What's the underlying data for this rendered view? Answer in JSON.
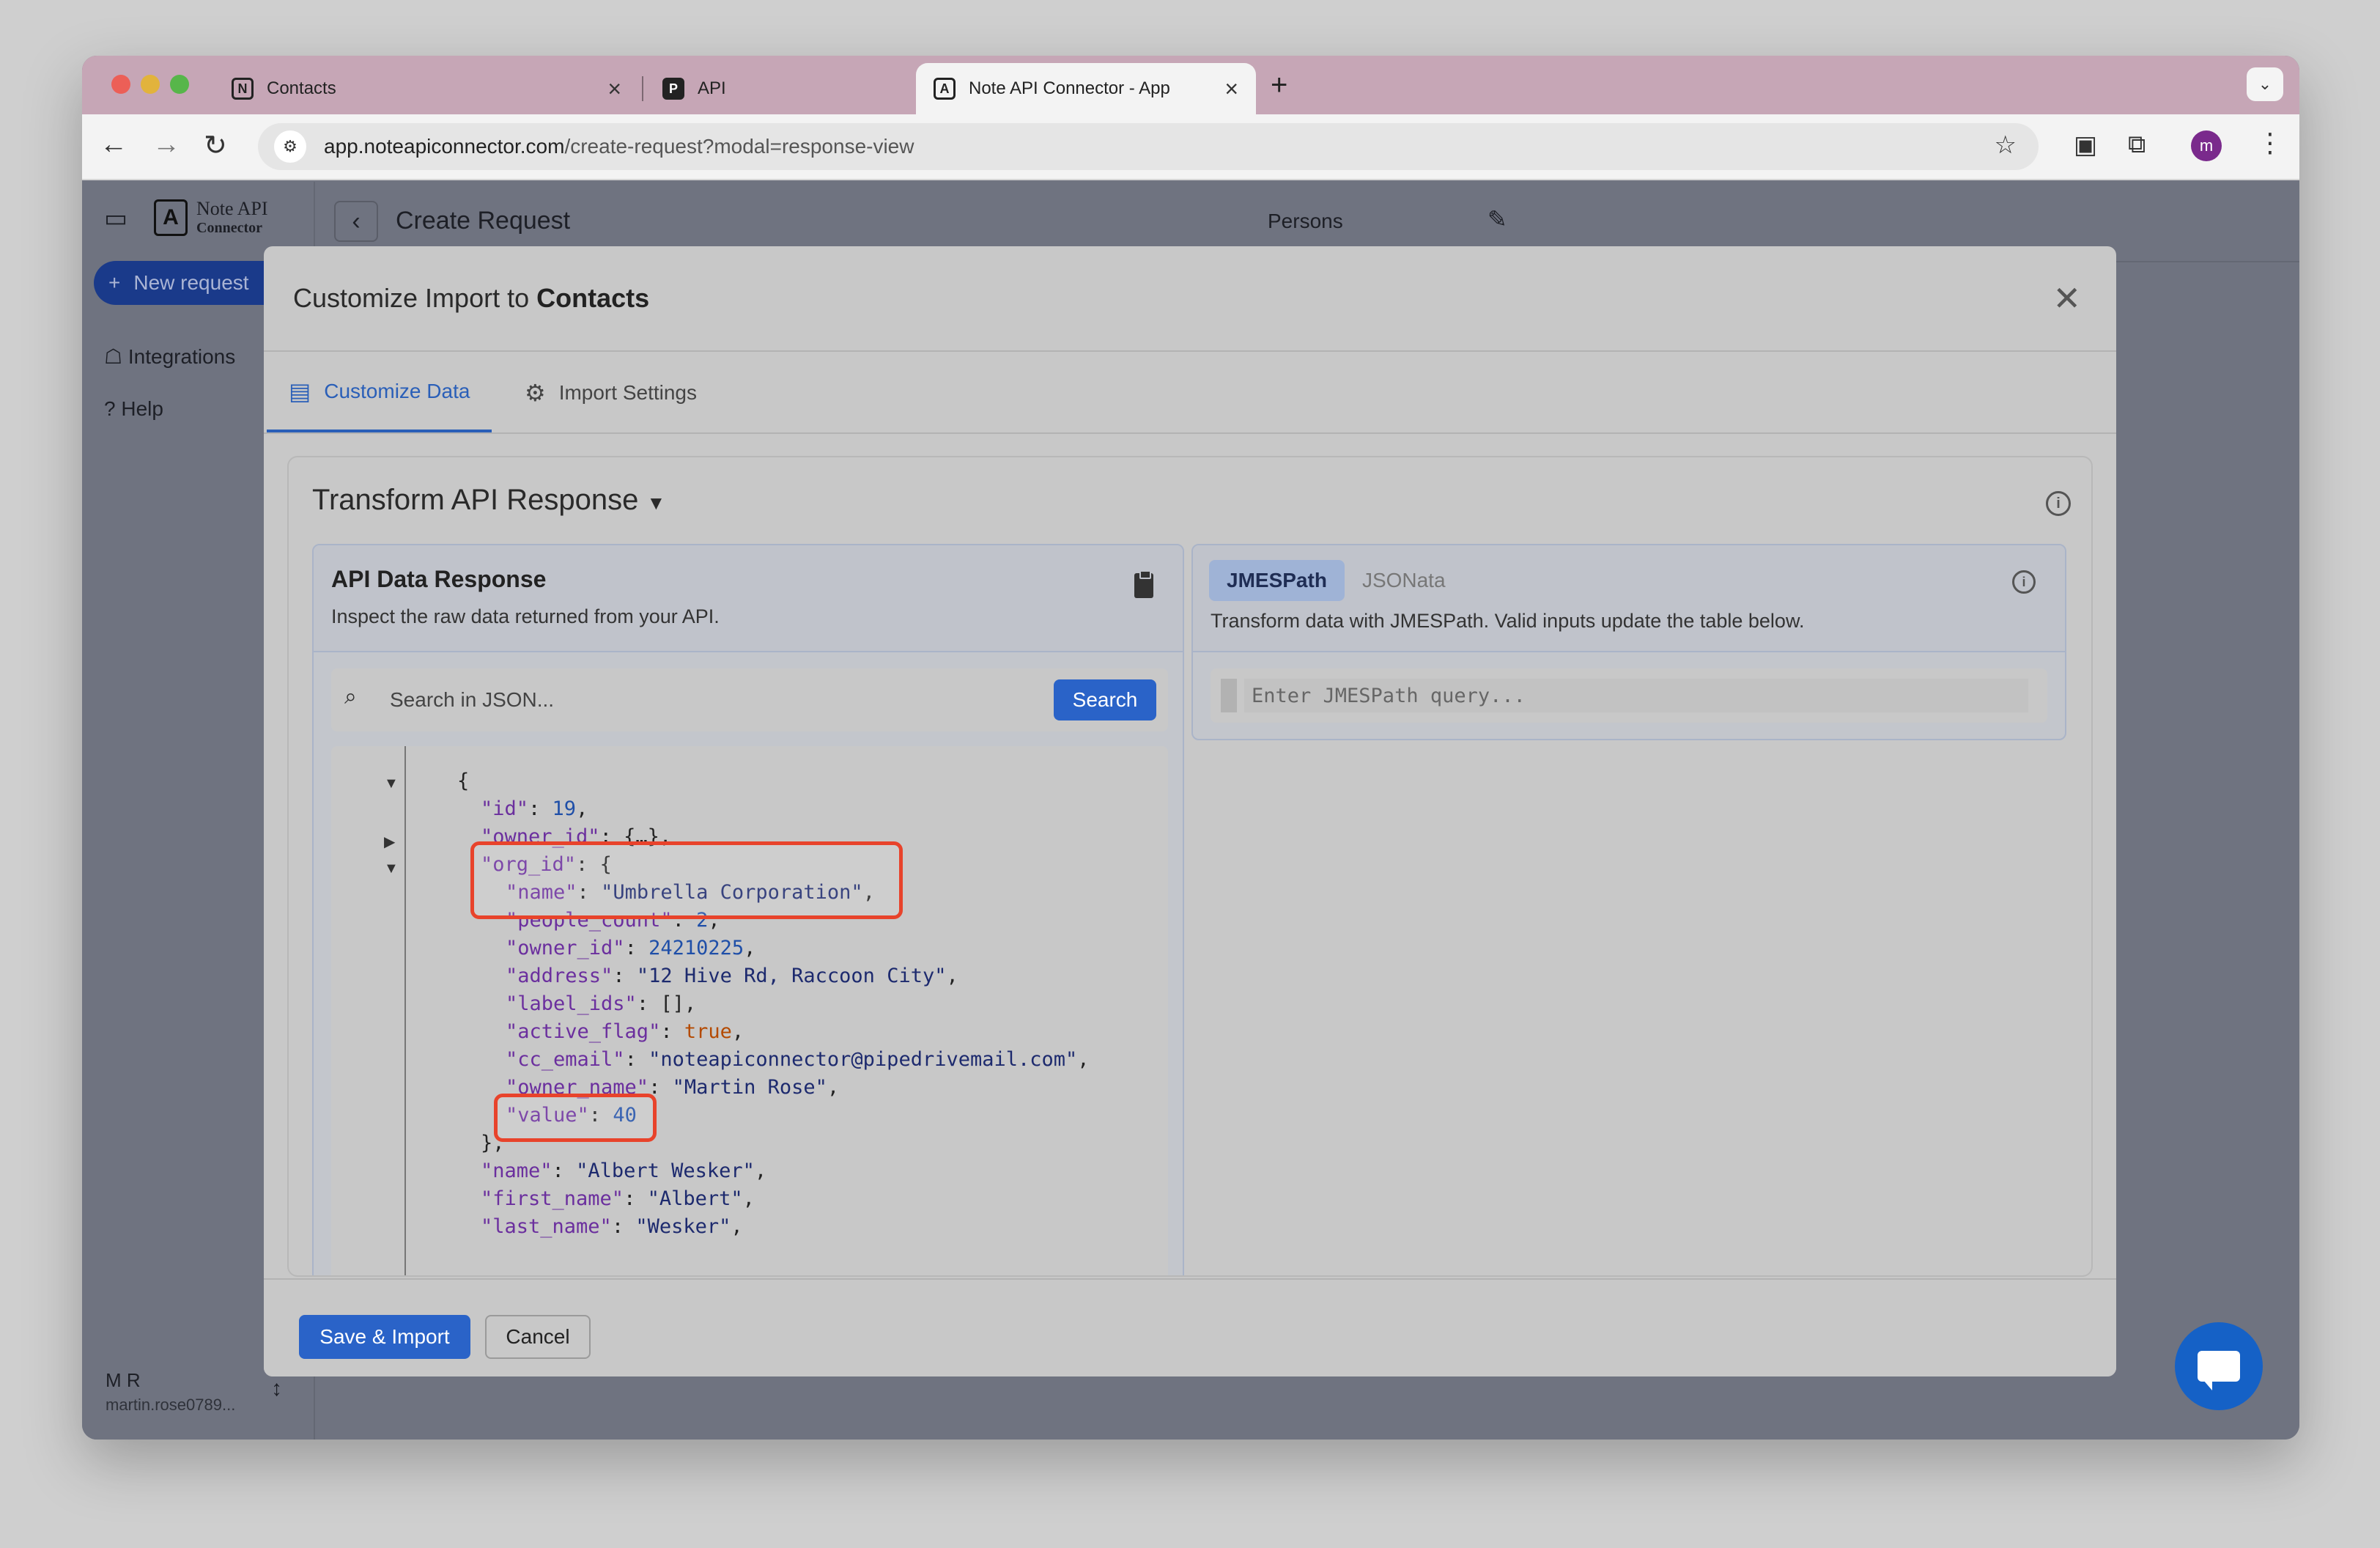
{
  "browser": {
    "tabs": [
      {
        "title": "Contacts",
        "favicon": "N"
      },
      {
        "title": "API",
        "favicon": "P"
      },
      {
        "title": "Note API Connector - App",
        "favicon": "A"
      }
    ],
    "url_domain": "app.noteapiconnector.com",
    "url_path": "/create-request?modal=response-view",
    "profile_initial": "m"
  },
  "app": {
    "logo_line1": "Note API",
    "logo_line2": "Connector",
    "logo_letter": "A",
    "new_request": "New request",
    "nav": [
      "Integrations",
      "Help"
    ],
    "page_title": "Create Request",
    "resource": "Persons",
    "user_initials": "M R",
    "user_email": "martin.rose0789..."
  },
  "modal": {
    "title_prefix": "Customize Import to",
    "title_target": "Contacts",
    "tabs": [
      "Customize Data",
      "Import Settings"
    ],
    "section_title": "Transform API Response",
    "left_panel": {
      "title": "API Data Response",
      "subtitle": "Inspect the raw data returned from your API.",
      "search_placeholder": "Search in JSON...",
      "search_button": "Search"
    },
    "right_panel": {
      "modes": [
        "JMESPath",
        "JSONata"
      ],
      "subtitle": "Transform data with JMESPath. Valid inputs update the table below.",
      "query_placeholder": "Enter JMESPath query..."
    },
    "footer": {
      "primary": "Save & Import",
      "secondary": "Cancel"
    }
  },
  "json_lines": {
    "l0": "{",
    "l1_k": "\"id\"",
    "l1_v": "19",
    "l2_k": "\"owner_id\"",
    "l2_v": "{…},",
    "l3_k": "\"org_id\"",
    "l3_v": "{",
    "l4_k": "\"name\"",
    "l4_v": "\"Umbrella Corporation\"",
    "l5_k": "\"people_count\"",
    "l5_v": "2",
    "l6_k": "\"owner_id\"",
    "l6_v": "24210225",
    "l7_k": "\"address\"",
    "l7_v": "\"12 Hive Rd, Raccoon City\"",
    "l8_k": "\"label_ids\"",
    "l8_v": "[]",
    "l9_k": "\"active_flag\"",
    "l9_v": "true",
    "l10_k": "\"cc_email\"",
    "l10_v": "\"noteapiconnector@pipedrivemail.com\"",
    "l11_k": "\"owner_name\"",
    "l11_v": "\"Martin Rose\"",
    "l12_k": "\"value\"",
    "l12_v": "40",
    "l13": "},",
    "l14_k": "\"name\"",
    "l14_v": "\"Albert Wesker\"",
    "l15_k": "\"first_name\"",
    "l15_v": "\"Albert\"",
    "l16_k": "\"last_name\"",
    "l16_v": "\"Wesker\""
  }
}
